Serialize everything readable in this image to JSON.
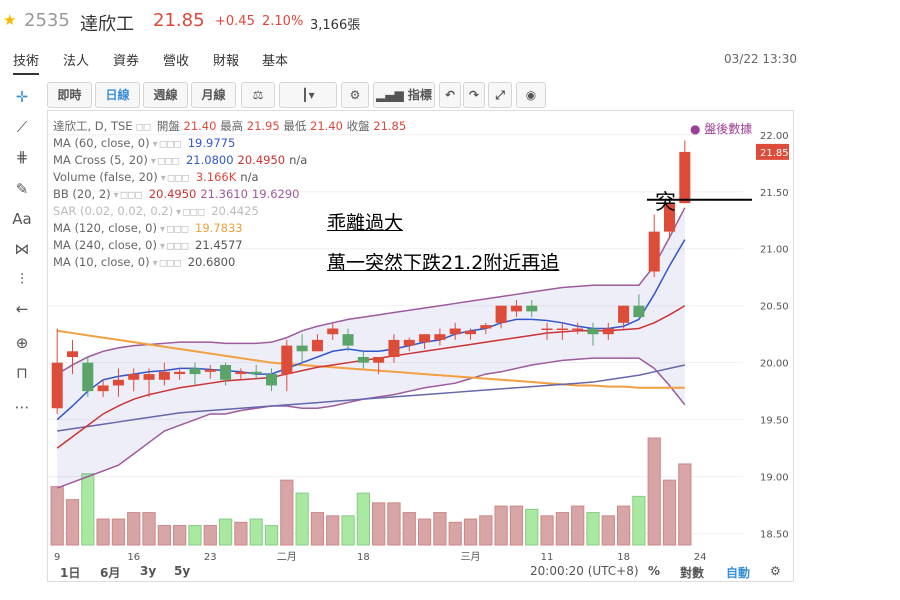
{
  "header": {
    "star_icon": "star-icon",
    "code": "2535",
    "name": "達欣工",
    "price": "21.85",
    "change": "+0.45",
    "percent": "2.10%",
    "volume": "3,166張",
    "datetime": "03/22 13:30"
  },
  "tabs": [
    {
      "label": "技術",
      "active": true
    },
    {
      "label": "法人"
    },
    {
      "label": "資券"
    },
    {
      "label": "營收"
    },
    {
      "label": "財報"
    },
    {
      "label": "基本"
    }
  ],
  "toolbar": {
    "intraday": "即時",
    "daily": "日線",
    "weekly": "週線",
    "monthly": "月線",
    "indicators": "指標"
  },
  "legend": {
    "main": {
      "label": "達欣工, D, TSE",
      "open_label": "開盤",
      "open": "21.40",
      "high_label": "最高",
      "high": "21.95",
      "low_label": "最低",
      "low": "21.40",
      "close_label": "收盤",
      "close": "21.85"
    },
    "studies": [
      {
        "label": "MA (60, close, 0)",
        "values": [
          "19.9775"
        ],
        "colors": [
          "#3355cc"
        ]
      },
      {
        "label": "MA Cross (5, 20)",
        "values": [
          "21.0800",
          "20.4950",
          "n/a"
        ],
        "colors": [
          "#3355cc",
          "#cc3333",
          "#555555"
        ]
      },
      {
        "label": "Volume (false, 20)",
        "values": [
          "3.166K",
          "n/a"
        ],
        "colors": [
          "#e0463a",
          "#555555"
        ]
      },
      {
        "label": "BB (20, 2)",
        "values": [
          "20.4950",
          "21.3610",
          "19.6290"
        ],
        "colors": [
          "#cc3333",
          "#9c5b9c",
          "#9c5b9c"
        ]
      },
      {
        "label": "SAR (0.02, 0.02, 0.2)",
        "values": [
          "20.4425"
        ],
        "colors": [
          "#bbbbbb"
        ],
        "dim": true
      },
      {
        "label": "MA (120, close, 0)",
        "values": [
          "19.7833"
        ],
        "colors": [
          "#e8a13a"
        ]
      },
      {
        "label": "MA (240, close, 0)",
        "values": [
          "21.4577"
        ],
        "colors": [
          "#555555"
        ]
      },
      {
        "label": "MA (10, close, 0)",
        "values": [
          "20.6800"
        ],
        "colors": [
          "#555555"
        ]
      }
    ],
    "after_market": "盤後數據"
  },
  "annotations": {
    "line1": "乖離過大",
    "line2": "萬一突然下跌21.2附近再追",
    "tag": "突"
  },
  "bottom": {
    "ranges": [
      "1日",
      "6月",
      "3y",
      "5y"
    ],
    "time": "20:00:20 (UTC+8)",
    "pct": "%",
    "log": "對數",
    "auto": "自動"
  },
  "colors": {
    "up": "#dd4b39",
    "down": "#5aa46a",
    "vol_up": "#d7a5a5",
    "vol_down": "#a8e8a0",
    "ma5": "#3355cc",
    "ma20": "#cc3333",
    "bb": "#9c5b9c",
    "ma120": "#f0a040",
    "ma60": "#6666aa"
  },
  "chart_data": {
    "type": "candlestick",
    "ylim": [
      18.4,
      22.2
    ],
    "y_ticks": [
      "22.00",
      "21.50",
      "21.00",
      "20.50",
      "20.00",
      "19.50",
      "19.00",
      "18.50"
    ],
    "last_price_label": "21.85",
    "x_ticks": [
      {
        "label": "9",
        "i": 0
      },
      {
        "label": "16",
        "i": 5
      },
      {
        "label": "23",
        "i": 10
      },
      {
        "label": "二月",
        "i": 15
      },
      {
        "label": "18",
        "i": 20
      },
      {
        "label": "三月",
        "i": 27
      },
      {
        "label": "11",
        "i": 32
      },
      {
        "label": "18",
        "i": 37
      },
      {
        "label": "24",
        "i": 42
      }
    ],
    "candles": [
      {
        "o": 19.6,
        "h": 20.3,
        "l": 19.55,
        "c": 20.0
      },
      {
        "o": 20.05,
        "h": 20.2,
        "l": 19.9,
        "c": 20.1
      },
      {
        "o": 20.0,
        "h": 20.05,
        "l": 19.7,
        "c": 19.75
      },
      {
        "o": 19.75,
        "h": 19.85,
        "l": 19.7,
        "c": 19.8
      },
      {
        "o": 19.8,
        "h": 19.95,
        "l": 19.7,
        "c": 19.85
      },
      {
        "o": 19.85,
        "h": 19.95,
        "l": 19.75,
        "c": 19.9
      },
      {
        "o": 19.85,
        "h": 19.95,
        "l": 19.7,
        "c": 19.9
      },
      {
        "o": 19.85,
        "h": 20.0,
        "l": 19.8,
        "c": 19.92
      },
      {
        "o": 19.9,
        "h": 19.95,
        "l": 19.85,
        "c": 19.92
      },
      {
        "o": 19.95,
        "h": 20.0,
        "l": 19.8,
        "c": 19.9
      },
      {
        "o": 19.92,
        "h": 19.98,
        "l": 19.86,
        "c": 19.94
      },
      {
        "o": 19.98,
        "h": 20.0,
        "l": 19.8,
        "c": 19.85
      },
      {
        "o": 19.9,
        "h": 19.95,
        "l": 19.85,
        "c": 19.92
      },
      {
        "o": 19.92,
        "h": 19.98,
        "l": 19.85,
        "c": 19.9
      },
      {
        "o": 19.9,
        "h": 19.95,
        "l": 19.75,
        "c": 19.8
      },
      {
        "o": 19.9,
        "h": 20.2,
        "l": 19.75,
        "c": 20.15
      },
      {
        "o": 20.15,
        "h": 20.25,
        "l": 20.0,
        "c": 20.1
      },
      {
        "o": 20.1,
        "h": 20.25,
        "l": 20.1,
        "c": 20.2
      },
      {
        "o": 20.25,
        "h": 20.35,
        "l": 20.2,
        "c": 20.3
      },
      {
        "o": 20.25,
        "h": 20.3,
        "l": 20.1,
        "c": 20.15
      },
      {
        "o": 20.05,
        "h": 20.1,
        "l": 19.95,
        "c": 20.0
      },
      {
        "o": 20.0,
        "h": 20.05,
        "l": 19.9,
        "c": 20.05
      },
      {
        "o": 20.05,
        "h": 20.25,
        "l": 20.0,
        "c": 20.2
      },
      {
        "o": 20.15,
        "h": 20.22,
        "l": 20.1,
        "c": 20.2
      },
      {
        "o": 20.18,
        "h": 20.25,
        "l": 20.12,
        "c": 20.25
      },
      {
        "o": 20.2,
        "h": 20.3,
        "l": 20.15,
        "c": 20.25
      },
      {
        "o": 20.25,
        "h": 20.35,
        "l": 20.2,
        "c": 20.3
      },
      {
        "o": 20.25,
        "h": 20.3,
        "l": 20.2,
        "c": 20.28
      },
      {
        "o": 20.3,
        "h": 20.35,
        "l": 20.25,
        "c": 20.33
      },
      {
        "o": 20.35,
        "h": 20.5,
        "l": 20.3,
        "c": 20.5
      },
      {
        "o": 20.45,
        "h": 20.55,
        "l": 20.4,
        "c": 20.5
      },
      {
        "o": 20.5,
        "h": 20.55,
        "l": 20.4,
        "c": 20.45
      },
      {
        "o": 20.3,
        "h": 20.35,
        "l": 20.2,
        "c": 20.3
      },
      {
        "o": 20.3,
        "h": 20.35,
        "l": 20.2,
        "c": 20.3
      },
      {
        "o": 20.3,
        "h": 20.35,
        "l": 20.25,
        "c": 20.3
      },
      {
        "o": 20.3,
        "h": 20.35,
        "l": 20.15,
        "c": 20.25
      },
      {
        "o": 20.25,
        "h": 20.35,
        "l": 20.2,
        "c": 20.3
      },
      {
        "o": 20.35,
        "h": 20.5,
        "l": 20.3,
        "c": 20.5
      },
      {
        "o": 20.5,
        "h": 20.6,
        "l": 20.4,
        "c": 20.4
      },
      {
        "o": 20.8,
        "h": 21.3,
        "l": 20.75,
        "c": 21.15
      },
      {
        "o": 21.15,
        "h": 21.45,
        "l": 21.1,
        "c": 21.4
      },
      {
        "o": 21.4,
        "h": 21.95,
        "l": 21.4,
        "c": 21.85
      }
    ],
    "ma5": [
      19.5,
      19.62,
      19.75,
      19.85,
      19.88,
      19.9,
      19.92,
      19.93,
      19.95,
      19.95,
      19.94,
      19.93,
      19.92,
      19.9,
      19.9,
      19.95,
      20.0,
      20.05,
      20.1,
      20.12,
      20.1,
      20.1,
      20.12,
      20.15,
      20.18,
      20.2,
      20.25,
      20.28,
      20.3,
      20.35,
      20.38,
      20.38,
      20.37,
      20.35,
      20.32,
      20.3,
      20.3,
      20.32,
      20.38,
      20.6,
      20.85,
      21.08
    ],
    "ma20": [
      19.25,
      19.35,
      19.45,
      19.55,
      19.62,
      19.68,
      19.72,
      19.75,
      19.78,
      19.8,
      19.82,
      19.84,
      19.85,
      19.86,
      19.87,
      19.9,
      19.93,
      19.96,
      19.98,
      20.0,
      20.02,
      20.04,
      20.06,
      20.08,
      20.1,
      20.12,
      20.14,
      20.16,
      20.18,
      20.2,
      20.22,
      20.24,
      20.26,
      20.27,
      20.28,
      20.28,
      20.28,
      20.29,
      20.3,
      20.35,
      20.42,
      20.5
    ],
    "bb_upper": [
      19.9,
      19.98,
      20.05,
      20.1,
      20.13,
      20.15,
      20.16,
      20.17,
      20.18,
      20.18,
      20.18,
      20.17,
      20.17,
      20.17,
      20.18,
      20.22,
      20.28,
      20.32,
      20.35,
      20.38,
      20.4,
      20.42,
      20.44,
      20.46,
      20.48,
      20.5,
      20.52,
      20.54,
      20.56,
      20.58,
      20.6,
      20.62,
      20.64,
      20.66,
      20.67,
      20.68,
      20.68,
      20.68,
      20.68,
      20.85,
      21.1,
      21.36
    ],
    "bb_lower": [
      18.9,
      18.95,
      19.0,
      19.05,
      19.1,
      19.2,
      19.3,
      19.4,
      19.45,
      19.5,
      19.55,
      19.55,
      19.58,
      19.6,
      19.62,
      19.62,
      19.6,
      19.6,
      19.62,
      19.65,
      19.68,
      19.7,
      19.72,
      19.75,
      19.78,
      19.8,
      19.82,
      19.86,
      19.9,
      19.92,
      19.95,
      19.98,
      20.0,
      20.02,
      20.03,
      20.04,
      20.04,
      20.04,
      20.04,
      19.95,
      19.8,
      19.63
    ],
    "ma120": [
      20.28,
      20.26,
      20.24,
      20.22,
      20.2,
      20.18,
      20.16,
      20.14,
      20.12,
      20.1,
      20.08,
      20.06,
      20.04,
      20.02,
      20.0,
      19.99,
      19.98,
      19.97,
      19.96,
      19.95,
      19.94,
      19.93,
      19.92,
      19.91,
      19.9,
      19.89,
      19.88,
      19.87,
      19.86,
      19.85,
      19.84,
      19.83,
      19.82,
      19.81,
      19.8,
      19.8,
      19.79,
      19.79,
      19.78,
      19.78,
      19.78,
      19.78
    ],
    "ma60": [
      19.4,
      19.42,
      19.44,
      19.46,
      19.48,
      19.5,
      19.52,
      19.54,
      19.56,
      19.57,
      19.58,
      19.59,
      19.6,
      19.61,
      19.62,
      19.63,
      19.64,
      19.65,
      19.66,
      19.67,
      19.68,
      19.69,
      19.7,
      19.71,
      19.72,
      19.73,
      19.74,
      19.75,
      19.76,
      19.77,
      19.78,
      19.79,
      19.8,
      19.81,
      19.82,
      19.83,
      19.85,
      19.87,
      19.89,
      19.92,
      19.95,
      19.98
    ],
    "volume": [
      900,
      700,
      1100,
      400,
      400,
      500,
      500,
      300,
      300,
      300,
      300,
      400,
      350,
      400,
      300,
      1000,
      800,
      500,
      450,
      450,
      800,
      650,
      650,
      500,
      400,
      500,
      350,
      400,
      450,
      600,
      600,
      550,
      450,
      500,
      600,
      500,
      450,
      600,
      750,
      1650,
      1000,
      1250
    ]
  }
}
